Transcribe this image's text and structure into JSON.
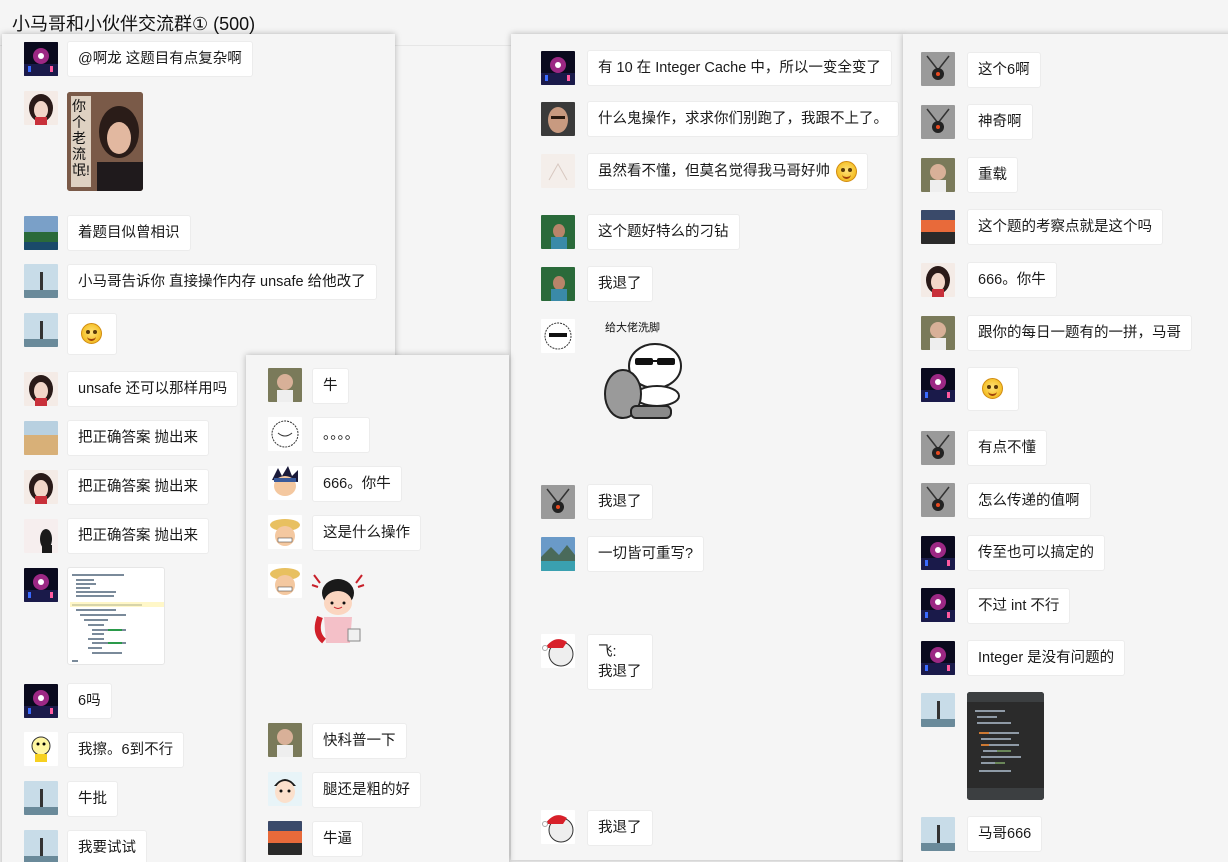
{
  "window": {
    "title": "小马哥和小伙伴交流群① (500)"
  },
  "panel1": {
    "messages": [
      {
        "text": "@啊龙 这题目有点复杂啊"
      },
      {
        "image": "meme-photo",
        "caption": "你个老流氓!"
      },
      {
        "text": "着题目似曾相识"
      },
      {
        "text": "小马哥告诉你  直接操作内存  unsafe 给他改了"
      },
      {
        "emoji": "grinning-emoji"
      },
      {
        "text": "unsafe  还可以那样用吗"
      },
      {
        "text": "把正确答案 抛出来"
      },
      {
        "text": "把正确答案 抛出来"
      },
      {
        "text": "把正确答案 抛出来"
      },
      {
        "image": "code-screenshot"
      },
      {
        "text": "6吗"
      },
      {
        "text": "我擦。6到不行"
      },
      {
        "text": "牛批"
      },
      {
        "text": "我要试试"
      }
    ]
  },
  "panel2": {
    "messages": [
      {
        "text": "牛"
      },
      {
        "text": "。。。。"
      },
      {
        "text": "666。你牛"
      },
      {
        "text": "这是什么操作"
      },
      {
        "image": "cartoon-girl-sticker"
      },
      {
        "text": "快科普一下"
      },
      {
        "text": "腿还是粗的好"
      },
      {
        "text": "牛逼"
      }
    ]
  },
  "panel3": {
    "messages": [
      {
        "text": "有 10 在 Integer Cache 中，所以一变全变了"
      },
      {
        "text": "什么鬼操作，求求你们别跑了，我跟不上了。"
      },
      {
        "text": "虽然看不懂，但莫名觉得我马哥好帅"
      },
      {
        "text": "这个题好特么的刁钻"
      },
      {
        "text": "我退了"
      },
      {
        "image": "sticker-boss-washing-feet",
        "caption": "给大佬洗脚"
      },
      {
        "text": "我退了"
      },
      {
        "text": "一切皆可重写?"
      },
      {
        "line1": "飞:",
        "line2": "我退了"
      },
      {
        "text": "我退了"
      }
    ]
  },
  "panel4": {
    "messages": [
      {
        "text": "这个6啊"
      },
      {
        "text": "神奇啊"
      },
      {
        "text": "重载"
      },
      {
        "text": "这个题的考察点就是这个吗"
      },
      {
        "text": "666。你牛"
      },
      {
        "text": "跟你的每日一题有的一拼，马哥"
      },
      {
        "emoji": "grinning-emoji"
      },
      {
        "text": "有点不懂"
      },
      {
        "text": "怎么传递的值啊"
      },
      {
        "text": "传至也可以搞定的"
      },
      {
        "text": "不过 int 不行"
      },
      {
        "text": "Integer 是没有问题的"
      },
      {
        "image": "dark-code-screenshot"
      },
      {
        "text": "马哥666"
      }
    ]
  },
  "colors": {
    "bubble": "#ffffff",
    "background": "#f5f5f5"
  }
}
